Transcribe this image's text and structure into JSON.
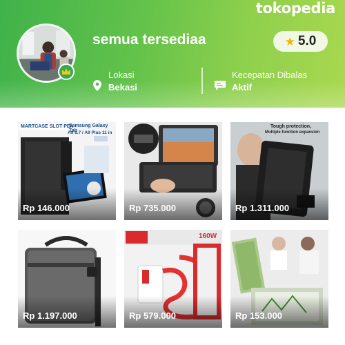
{
  "brand": "tokopedia",
  "shop": {
    "name": "semua tersediaa",
    "rating": "5.0"
  },
  "info": {
    "location_label": "Lokasi",
    "location_value": "Bekasi",
    "response_label": "Kecepatan Dibalas",
    "response_value": "Aktif"
  },
  "icons": {
    "location": "map-pin-icon",
    "response": "chat-bubble-icon",
    "rating": "star-icon",
    "badge": "crown-icon"
  },
  "colors": {
    "header_start": "#3fb24a",
    "header_end": "#a9d84f",
    "badge": "#34a853",
    "star": "#f5b400"
  },
  "products": [
    {
      "price": "Rp 146.000",
      "image_text": [
        "MARTCASE SLOT PEN",
        "Samsung Galaxy Tab",
        "A9 8.7 / A9 Plus 11 in"
      ]
    },
    {
      "price": "Rp 735.000"
    },
    {
      "price": "Rp 1.311.000",
      "image_text": [
        "Tough protection,",
        "Multiple function expansion"
      ]
    },
    {
      "price": "Rp 1.197.000"
    },
    {
      "price": "Rp 579.000",
      "image_text": [
        "160W"
      ]
    },
    {
      "price": "Rp 153.000"
    }
  ]
}
